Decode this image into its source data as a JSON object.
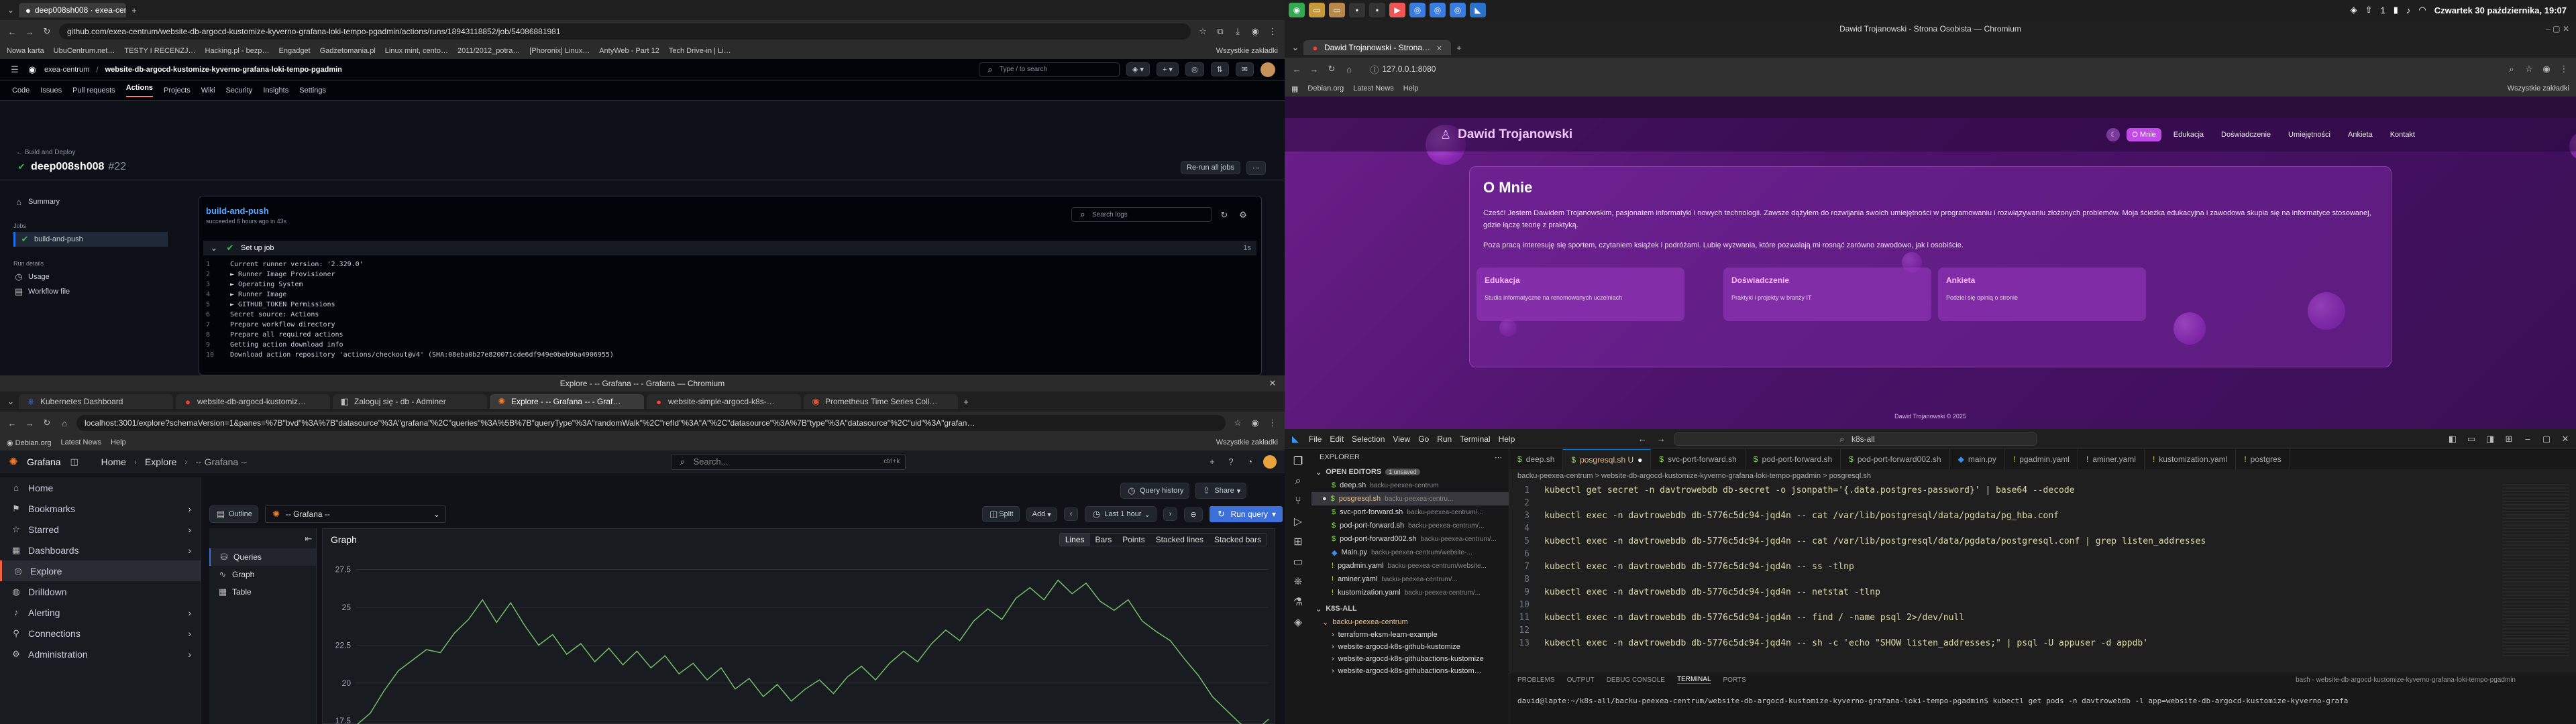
{
  "system": {
    "clock": "Czwartek 30 października, 19:07",
    "top_window_title": "Dawid Trojanowski - Strona Osobista — Chromium"
  },
  "github_window": {
    "tab_title": "deep008sh008 · exea-centrum",
    "url": "github.com/exea-centrum/website-db-argocd-kustomize-kyverno-grafana-loki-tempo-pgadmin/actions/runs/18943118852/job/54086881981",
    "bookmarks": [
      "Nowa karta",
      "UbuCentrum.net…",
      "TESTY I RECENZJ…",
      "Hacking.pl - bezp…",
      "Engadget",
      "Gadżetomania.pl",
      "Linux mint, cento…",
      "2011/2012_potra…",
      "[Phoronix] Linux…",
      "AntyWeb - Part 12",
      "Tech Drive-in | Li…"
    ],
    "all_bookmarks": "Wszystkie zakładki",
    "org": "exea-centrum",
    "repo": "website-db-argocd-kustomize-kyverno-grafana-loki-tempo-pgadmin",
    "search_placeholder": "Type / to search",
    "nav": [
      "Code",
      "Issues",
      "Pull requests",
      "Actions",
      "Projects",
      "Wiki",
      "Security",
      "Insights",
      "Settings"
    ],
    "breadcrumb": "Build and Deploy",
    "run_title": "deep008sh008",
    "run_number": "#22",
    "rerun": "Re-run all jobs",
    "summary": "Summary",
    "jobs_label": "Jobs",
    "job": "build-and-push",
    "run_details": "Run details",
    "usage": "Usage",
    "workflow_file": "Workflow file",
    "job_title": "build-and-push",
    "job_status": "succeeded 6 hours ago in 43s",
    "search_logs": "Search logs",
    "step": "Set up job",
    "step_time": "1s",
    "log_lines": [
      "Current runner version: '2.329.0'",
      "► Runner Image Provisioner",
      "► Operating System",
      "► Runner Image",
      "► GITHUB_TOKEN Permissions",
      "Secret source: Actions",
      "Prepare workflow directory",
      "Prepare all required actions",
      "Getting action download info",
      "Download action repository 'actions/checkout@v4' (SHA:08eba0b27e820071cde6df949e0beb9ba4906955)"
    ]
  },
  "grafana_window": {
    "window_title": "Explore - -- Grafana -- - Grafana — Chromium",
    "tabs": [
      "Kubernetes Dashboard",
      "website-db-argocd-kustomiz…",
      "Zaloguj się - db - Adminer",
      "Explore - -- Grafana -- - Graf…",
      "website-simple-argocd-k8s-…",
      "Prometheus Time Series Coll…"
    ],
    "url": "localhost:3001/explore?schemaVersion=1&panes=%7B\"bvd\"%3A%7B\"datasource\"%3A\"grafana\"%2C\"queries\"%3A%5B%7B\"queryType\"%3A\"randomWalk\"%2C\"refId\"%3A\"A\"%2C\"datasource\"%3A%7B\"type\"%3A\"datasource\"%2C\"uid\"%3A\"grafan…",
    "bookmarks": [
      "Debian.org",
      "Latest News",
      "Help"
    ],
    "all_bookmarks": "Wszystkie zakładki",
    "app": "Grafana",
    "breadcrumb": [
      "Home",
      "Explore",
      "-- Grafana --"
    ],
    "search": "Search...",
    "shortcut": "ctrl+k",
    "nav": [
      "Home",
      "Bookmarks",
      "Starred",
      "Dashboards",
      "Explore",
      "Drilldown",
      "Alerting",
      "Connections",
      "Administration"
    ],
    "toolbar": {
      "query_history": "Query history",
      "share": "Share",
      "outline": "Outline",
      "datasource": "-- Grafana --",
      "split": "Split",
      "add": "Add",
      "time_range": "Last 1 hour",
      "run_query": "Run query"
    },
    "outline_items": [
      "Queries",
      "Graph",
      "Table"
    ],
    "panel_title": "Graph",
    "views": [
      "Lines",
      "Bars",
      "Points",
      "Stacked lines",
      "Stacked bars"
    ],
    "y_ticks": [
      "27.5",
      "25",
      "22.5",
      "20",
      "17.5"
    ]
  },
  "site_window": {
    "tab": "Dawid Trojanowski - Strona…",
    "url": "127.0.0.1:8080",
    "bookmarks": [
      "Debian.org",
      "Latest News",
      "Help"
    ],
    "all_bookmarks": "Wszystkie zakładki",
    "brand": "Dawid Trojanowski",
    "nav": [
      "O Mnie",
      "Edukacja",
      "Doświadczenie",
      "Umiejętności",
      "Ankieta",
      "Kontakt"
    ],
    "heading": "O Mnie",
    "para1": "Cześć! Jestem Dawidem Trojanowskim, pasjonatem informatyki i nowych technologii. Zawsze dążyłem do rozwijania swoich umiejętności w programowaniu i rozwiązywaniu złożonych problemów. Moja ścieżka edukacyjna i zawodowa skupia się na informatyce stosowanej, gdzie łączę teorię z praktyką.",
    "para2": "Poza pracą interesuję się sportem, czytaniem książek i podróżami. Lubię wyzwania, które pozwalają mi rosnąć zarówno zawodowo, jak i osobiście.",
    "cards": [
      {
        "title": "Edukacja",
        "text": "Studia informatyczne na renomowanych uczelniach"
      },
      {
        "title": "Doświadczenie",
        "text": "Praktyki i projekty w branży IT"
      },
      {
        "title": "Ankieta",
        "text": "Podziel się opinią o stronie"
      }
    ],
    "footer": "Dawid Trojanowski © 2025"
  },
  "vscode": {
    "menu": [
      "File",
      "Edit",
      "Selection",
      "View",
      "Go",
      "Run",
      "Terminal",
      "Help"
    ],
    "search": "k8s-all",
    "explorer": "EXPLORER",
    "open_editors": "OPEN EDITORS",
    "unsaved": "1 unsaved",
    "open_files": [
      {
        "name": "deep.sh",
        "path": "backu-peexea-centrum"
      },
      {
        "name": "posgresql.sh",
        "path": "backu-peexea-centru..."
      },
      {
        "name": "svc-port-forward.sh",
        "path": "backu-peexea-centrum/..."
      },
      {
        "name": "pod-port-forward.sh",
        "path": "backu-peexea-centrum/..."
      },
      {
        "name": "pod-port-forward002.sh",
        "path": "backu-peexea-centrum/..."
      },
      {
        "name": "Main.py",
        "path": "backu-peexea-centrum/website-..."
      },
      {
        "name": "pgadmin.yaml",
        "path": "backu-peexea-centrum/website..."
      },
      {
        "name": "aminer.yaml",
        "path": "backu-peexea-centrum/..."
      },
      {
        "name": "kustomization.yaml",
        "path": "backu-peexea-centrum/..."
      }
    ],
    "workspace": "K8S-ALL",
    "folder": "backu-peexea-centrum",
    "tree": [
      "terraform-eksm-learn-example",
      "website-argocd-k8s-github-kustomize",
      "website-argocd-k8s-githubactions-kustomize",
      "website-argocd-k8s-githubactions-kustom…"
    ],
    "tabs": [
      "deep.sh",
      "posgresql.sh U",
      "svc-port-forward.sh",
      "pod-port-forward.sh",
      "pod-port-forward002.sh",
      "main.py",
      "pgadmin.yaml",
      "aminer.yaml",
      "kustomization.yaml",
      "postgres"
    ],
    "breadcrumb": "backu-peexea-centrum > website-db-argocd-kustomize-kyverno-grafana-loki-tempo-pgadmin > posgresql.sh",
    "code": [
      "kubectl get secret -n davtrowebdb db-secret -o jsonpath='{.data.postgres-password}' | base64 --decode",
      "",
      "kubectl exec -n davtrowebdb db-5776c5dc94-jqd4n -- cat /var/lib/postgresql/data/pgdata/pg_hba.conf",
      "",
      "kubectl exec -n davtrowebdb db-5776c5dc94-jqd4n -- cat /var/lib/postgresql/data/pgdata/postgresql.conf | grep listen_addresses",
      "",
      "kubectl exec -n davtrowebdb db-5776c5dc94-jqd4n -- ss -tlnp",
      "",
      "kubectl exec -n davtrowebdb db-5776c5dc94-jqd4n -- netstat -tlnp",
      "",
      "kubectl exec -n davtrowebdb db-5776c5dc94-jqd4n -- find / -name psql 2>/dev/null",
      "",
      "kubectl exec -n davtrowebdb db-5776c5dc94-jqd4n -- sh -c 'echo \"SHOW listen_addresses;\" | psql -U appuser -d appdb'"
    ],
    "panel_tabs": [
      "PROBLEMS",
      "OUTPUT",
      "DEBUG CONSOLE",
      "TERMINAL",
      "PORTS"
    ],
    "terminal_name": "bash - website-db-argocd-kustomize-kyverno-grafana-loki-tempo-pgadmin",
    "terminal_line": "david@lapte:~/k8s-all/backu-peexea-centrum/website-db-argocd-kustomize-kyverno-grafana-loki-tempo-pgadmin$ kubectl get pods -n davtrowebdb -l app=website-db-argocd-kustomize-kyverno-grafa"
  },
  "chart_data": {
    "type": "line",
    "y_ticks": [
      17.5,
      20,
      22.5,
      25,
      27.5
    ],
    "ylim": [
      16,
      28.5
    ],
    "series": [
      {
        "values": [
          17.2,
          18,
          19.5,
          20.8,
          21.5,
          22.2,
          22,
          23.3,
          24.2,
          25.5,
          24,
          25.3,
          23.8,
          22.5,
          23.2,
          21.9,
          22.6,
          21.4,
          22.3,
          21.2,
          22.1,
          21,
          21.8,
          20.6,
          21.3,
          20.2,
          21,
          19.6,
          20.3,
          19.1,
          19.9,
          18.8,
          19.6,
          20.2,
          19.3,
          20.4,
          21.1,
          20.2,
          21.3,
          22.1,
          21.4,
          22.6,
          23.5,
          22.8,
          24.1,
          24.9,
          24.2,
          25.6,
          26.3,
          25.5,
          26.8,
          25.9,
          26.6,
          25.4,
          24.8,
          25.5,
          24.1,
          23.4,
          22.8,
          21.6,
          20.5,
          19.1,
          18.2,
          17.3,
          16.8,
          17.6
        ]
      }
    ]
  }
}
